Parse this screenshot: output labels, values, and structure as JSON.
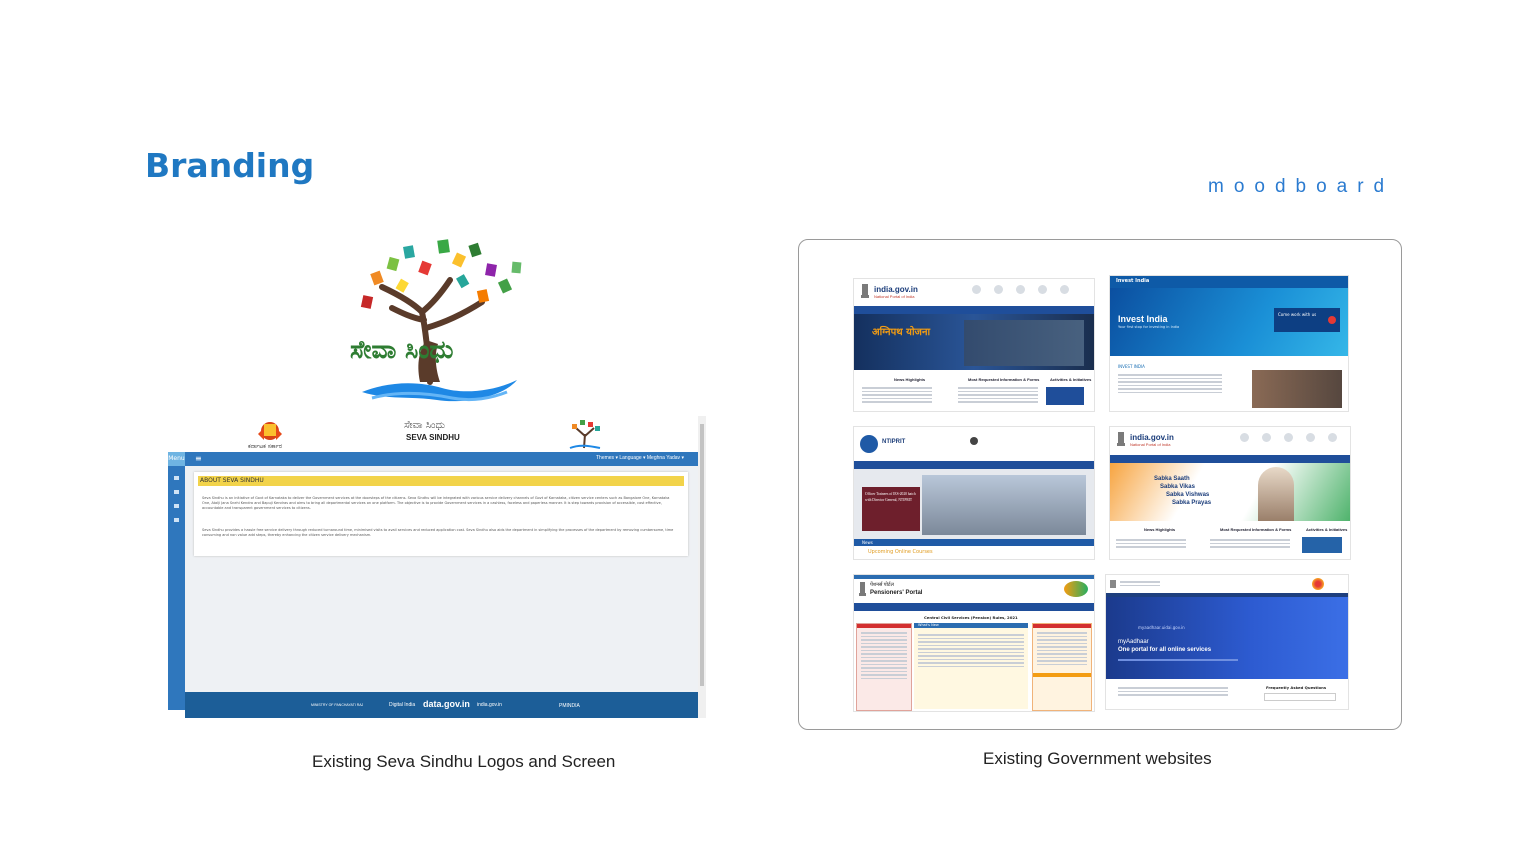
{
  "page": {
    "title": "Branding",
    "tag": "moodboard"
  },
  "left": {
    "caption": "Existing Seva Sindhu Logos and Screen",
    "logo_text_kn": "ಸೇವಾ ಸಿಂಧು",
    "screen": {
      "govt_label": "ಕರ್ನಾಟಕ ಸರ್ಕಾರ",
      "brand_kn": "ಸೇವಾ ಸಿಂಧು",
      "brand": "SEVA SINDHU",
      "menu": "Menu",
      "top_links": "Themes ▾  Language ▾   Meghna Yadav ▾",
      "card_title": "ABOUT SEVA SINDHU",
      "para1": "Seva Sindhu is an initiative of Govt of Karnataka to deliver the Government services at the doorsteps of the citizens. Seva Sindhu will be integrated with various service delivery channels of Govt of Karnataka, citizen service centers such as Bangalore One, Karnataka One, Atalji Jana Snehi Kendra and Bapuji Kendras and aims to bring all departmental services on one platform. The objective is to provide Government services in a cashless, faceless and paperless manner. It is step towards provision of accessible, cost effective, accountable and transparent government services to citizens.",
      "para2": "Seva Sindhu provides a hassle free service delivery through reduced turnaround time, minimised visits to avail services and reduced application cost. Seva Sindhu also aids the department in simplifying the processes of the department by removing cumbersome, time consuming and non value add steps, thereby enhancing the citizen service delivery mechanism.",
      "footer": [
        "MINISTRY OF PANCHAYATI RAJ",
        "Digital India",
        "data.gov.in",
        "india.gov.in",
        "PMINDIA"
      ]
    }
  },
  "right": {
    "caption": "Existing Government websites",
    "sites": [
      {
        "title": "india.gov.in",
        "sub": "National Portal of India",
        "headings": [
          "News Highlights",
          "Most Requested Information & Forms",
          "Activities & Initiatives"
        ],
        "banner_text": "अग्निपथ योजना"
      },
      {
        "title": "Invest India",
        "sub": "Your first stop for investing in India",
        "section": "INVEST INDIA",
        "cta": "Come work with us"
      },
      {
        "title": "NTIPRIT",
        "banner_text": "Officer Trainees of IES-2020 batch with Director General, NTIPRIT",
        "courses": "Upcoming Online Courses",
        "news": "News"
      },
      {
        "title": "india.gov.in",
        "sub": "National Portal of India",
        "banner_lines": [
          "Sabka Saath",
          "Sabka Vikas",
          "Sabka Vishwas",
          "Sabka Prayas"
        ],
        "headings": [
          "News Highlights",
          "Most Requested Information & Forms",
          "Activities & Initiatives"
        ]
      },
      {
        "title": "Pensioners' Portal",
        "title_hi": "पेंशनर्स पोर्टल",
        "notice": "Central Civil Services (Pension) Rules, 2021",
        "whats_new": "What's New"
      },
      {
        "title": "myAadhaar",
        "tagline": "One portal for all online services",
        "label": "myaadhaar.uidai.gov.in",
        "faq": "Frequently Asked Questions"
      }
    ]
  },
  "colors": {
    "accent": "#1f78c2",
    "seva_blue": "#2f77bd",
    "seva_yellow": "#f2d34a"
  }
}
